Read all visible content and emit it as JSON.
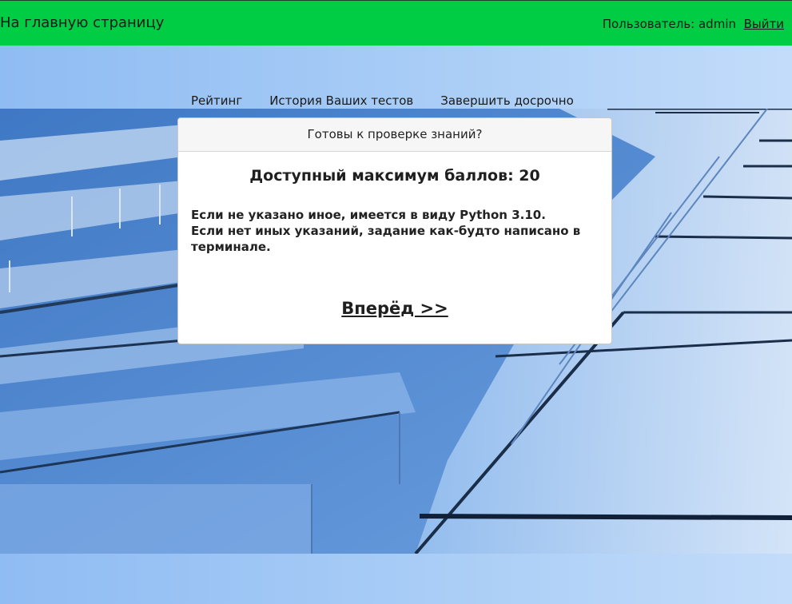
{
  "header": {
    "home_label": "На главную страницу",
    "user_label": "Пользователь: admin",
    "logout_label": "Выйти",
    "bg_color": "#00cc44"
  },
  "tabs": [
    {
      "label": "Рейтинг"
    },
    {
      "label": "История Ваших тестов"
    },
    {
      "label": "Завершить досрочно"
    }
  ],
  "card": {
    "header": "Готовы к проверке знаний?",
    "title": "Доступный максимум баллов: 20",
    "lines": [
      "Если не указано иное, имеется в виду Python 3.10.",
      "Если нет иных указаний, задание как-будто написано в терминале."
    ],
    "next_label": "Вперёд >>"
  }
}
